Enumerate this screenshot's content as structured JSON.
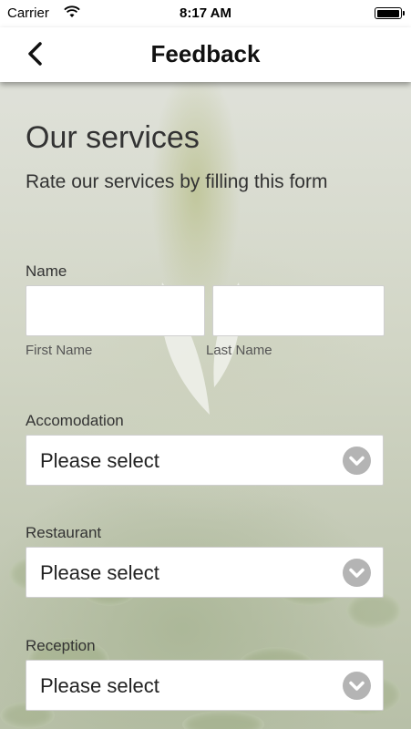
{
  "status_bar": {
    "carrier": "Carrier",
    "time": "8:17 AM",
    "wifi_icon": "wifi-icon",
    "battery_icon": "battery-icon"
  },
  "nav": {
    "title": "Feedback",
    "back_icon": "chevron-left-icon"
  },
  "form": {
    "title": "Our services",
    "subtitle": "Rate our services by filling this form",
    "name": {
      "label": "Name",
      "first_name_value": "",
      "last_name_value": "",
      "first_name_hint": "First Name",
      "last_name_hint": "Last Name"
    },
    "selects": [
      {
        "label": "Accomodation",
        "value": "Please select"
      },
      {
        "label": "Restaurant",
        "value": "Please select"
      },
      {
        "label": "Reception",
        "value": "Please select"
      }
    ]
  },
  "colors": {
    "nav_background": "#ffffff",
    "chevron_circle": "#b4b4b4",
    "text": "#333333"
  }
}
